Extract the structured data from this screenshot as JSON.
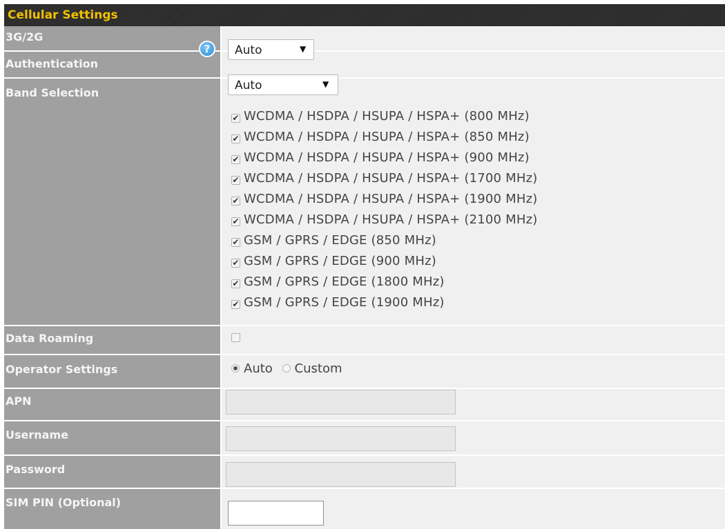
{
  "header": {
    "title": "Cellular Settings"
  },
  "rows": {
    "network": {
      "label": "3G/2G",
      "value": "Auto"
    },
    "authentication": {
      "label": "Authentication",
      "value": "Auto"
    },
    "band_selection": {
      "label": "Band Selection",
      "bands": [
        "WCDMA / HSDPA / HSUPA / HSPA+ (800 MHz)",
        "WCDMA / HSDPA / HSUPA / HSPA+ (850 MHz)",
        "WCDMA / HSDPA / HSUPA / HSPA+ (900 MHz)",
        "WCDMA / HSDPA / HSUPA / HSPA+ (1700 MHz)",
        "WCDMA / HSDPA / HSUPA / HSPA+ (1900 MHz)",
        "WCDMA / HSDPA / HSUPA / HSPA+ (2100 MHz)",
        "GSM / GPRS / EDGE (850 MHz)",
        "GSM / GPRS / EDGE (900 MHz)",
        "GSM / GPRS / EDGE (1800 MHz)",
        "GSM / GPRS / EDGE (1900 MHz)"
      ]
    },
    "data_roaming": {
      "label": "Data Roaming"
    },
    "operator_settings": {
      "label": "Operator Settings",
      "option_auto": "Auto",
      "option_custom": "Custom"
    },
    "apn": {
      "label": "APN",
      "value": ""
    },
    "username": {
      "label": "Username",
      "value": ""
    },
    "password": {
      "label": "Password",
      "value": ""
    },
    "sim_pin": {
      "label": "SIM PIN (Optional)",
      "value": ""
    }
  },
  "icons": {
    "help": "help-question-icon",
    "dropdown": "dropdown-arrow-icon",
    "check": "checkmark-icon"
  },
  "colors": {
    "header_title": "#f0c000",
    "label_bg": "#a0a0a0",
    "content_bg": "#f0f0f0",
    "help_icon": "#2f8fd8"
  }
}
